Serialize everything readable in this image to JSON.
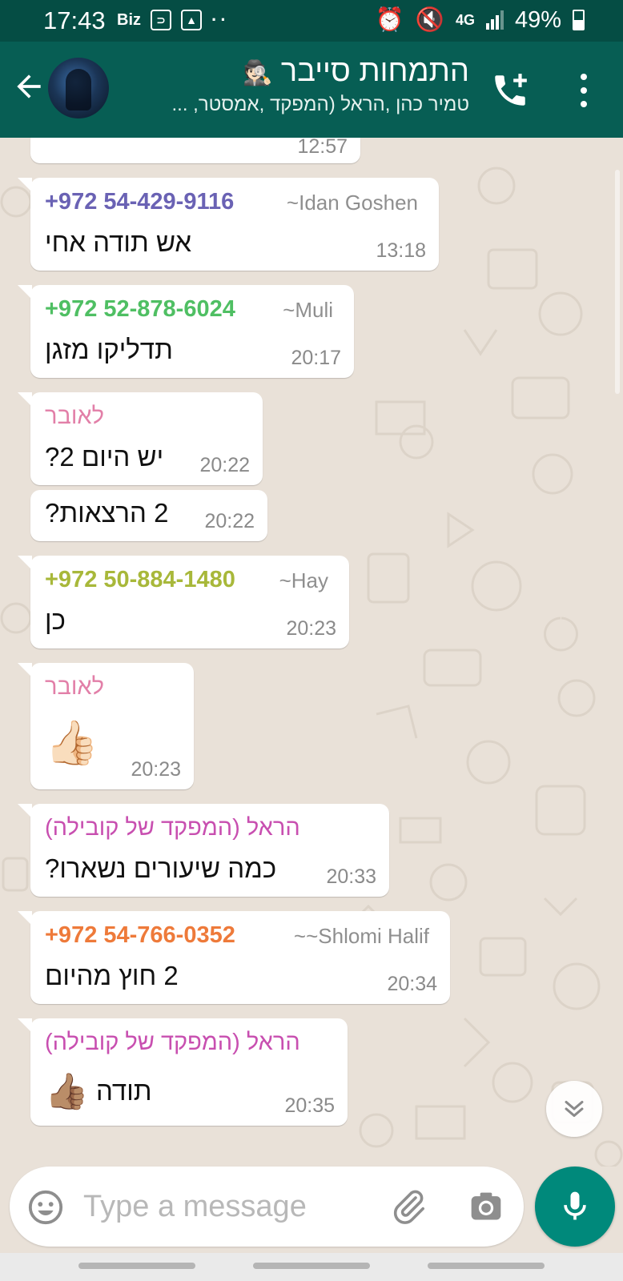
{
  "status_bar": {
    "time": "17:43",
    "biz_label": "Biz",
    "network": "4G",
    "battery": "49%",
    "battery_level": 0.49
  },
  "header": {
    "title": "התמחות סייבר",
    "title_emoji": "🕵🏻",
    "members": "טמיר כהן ,הראל (המפקד ,אמסטר, ..."
  },
  "messages": [
    {
      "id": "m0",
      "time": "12:57"
    },
    {
      "id": "m1",
      "phone": "+972 54-429-9116",
      "name": "~Idan Goshen",
      "text": "אש תודה אחי",
      "time": "13:18",
      "color": "#6a62b4"
    },
    {
      "id": "m2",
      "phone": "+972 52-878-6024",
      "name": "~Muli",
      "text": "תדליקו מזגן",
      "time": "20:17",
      "color": "#4fbf63"
    },
    {
      "id": "m3",
      "sender": "לאובר",
      "text": "יש היום 2?",
      "time": "20:22",
      "color": "#e27fa8"
    },
    {
      "id": "m4",
      "text": "2 הרצאות?",
      "time": "20:22"
    },
    {
      "id": "m5",
      "phone": "+972 50-884-1480",
      "name": "~Hay",
      "text": "כן",
      "time": "20:23",
      "color": "#a8b83a"
    },
    {
      "id": "m6",
      "sender": "לאובר",
      "emoji": "👍🏻",
      "time": "20:23",
      "color": "#e27fa8"
    },
    {
      "id": "m7",
      "sender": "הראל (המפקד של קובילה)",
      "text": "כמה שיעורים נשארו?",
      "time": "20:33",
      "color": "#c84fb0"
    },
    {
      "id": "m8",
      "phone": "+972 54-766-0352",
      "name": "~~Shlomi Halif",
      "text": "2 חוץ מהיום",
      "time": "20:34",
      "color": "#ee7a3a"
    },
    {
      "id": "m9",
      "sender": "הראל (המפקד של קובילה)",
      "text": "תודה",
      "emoji": "👍🏽",
      "time": "20:35",
      "color": "#c84fb0"
    }
  ],
  "composer": {
    "placeholder": "Type a message"
  },
  "icons": {
    "back": "arrow-left-icon",
    "call": "add-call-icon",
    "menu": "more-vert-icon",
    "emoji": "smiley-icon",
    "attach": "paperclip-icon",
    "camera": "camera-icon",
    "mic": "mic-icon",
    "scroll": "chevron-double-down-icon"
  }
}
